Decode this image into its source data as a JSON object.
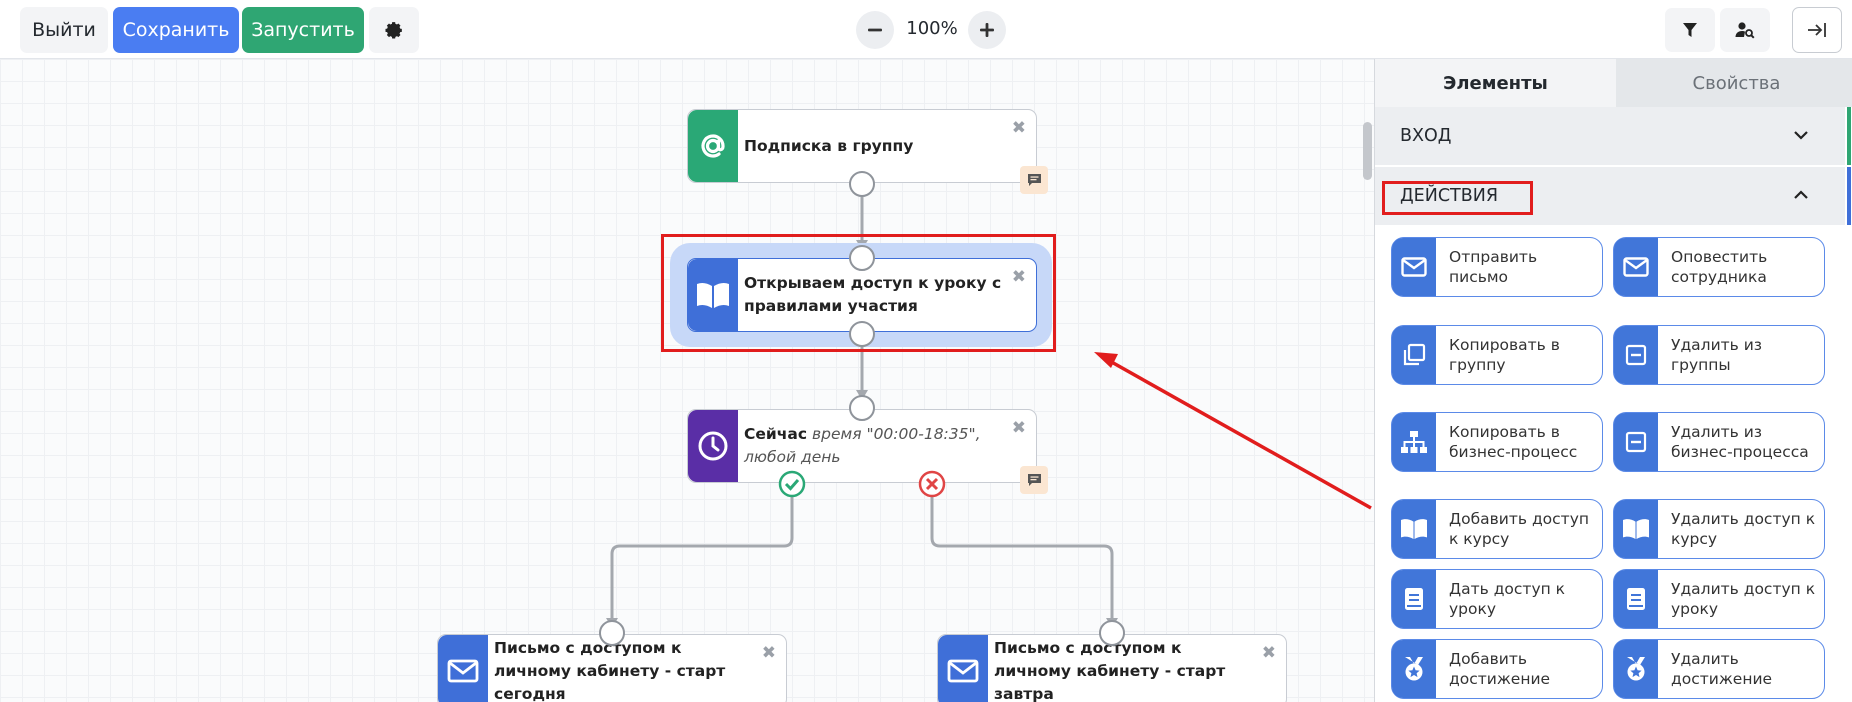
{
  "toolbar": {
    "exit_label": "Выйти",
    "save_label": "Сохранить",
    "run_label": "Запустить",
    "zoom_level": "100%",
    "colors": {
      "save": "#4a7df2",
      "run": "#2fa673"
    }
  },
  "canvas": {
    "nodes": [
      {
        "id": "subscribe",
        "title": "Подписка в группу",
        "icon": "at-icon",
        "color": "#2aa876"
      },
      {
        "id": "open-access",
        "title": "Открываем доступ к уроку с правилами участия",
        "icon": "book-icon",
        "color": "#3f6fd8"
      },
      {
        "id": "condition",
        "title": "Сейчас",
        "detail": "время \"00:00-18:35\", любой день",
        "icon": "clock-icon",
        "color": "#5a2ea6"
      },
      {
        "id": "letter-today",
        "title": "Письмо с доступом к личному кабинету - старт сегодня",
        "icon": "envelope-icon",
        "color": "#3f6fd8"
      },
      {
        "id": "letter-tomorrow",
        "title": "Письмо с доступом к личному кабинету - старт завтра",
        "icon": "envelope-icon",
        "color": "#3f6fd8"
      }
    ],
    "close_glyph": "✖"
  },
  "panel": {
    "tabs": {
      "elements": "Элементы",
      "properties": "Свойства"
    },
    "sections": {
      "input": "ВХОД",
      "actions": "ДЕЙСТВИЯ"
    },
    "section_colors": {
      "input": "#2fa673",
      "actions": "#3f6fd8"
    },
    "actions": [
      {
        "label": "Отправить письмо",
        "icon": "envelope-icon"
      },
      {
        "label": "Оповестить сотрудника",
        "icon": "envelope-icon"
      },
      {
        "label": "Копировать в группу",
        "icon": "copy-icon"
      },
      {
        "label": "Удалить из группы",
        "icon": "minus-box-icon"
      },
      {
        "label": "Копировать в бизнес-процесс",
        "icon": "sitemap-icon"
      },
      {
        "label": "Удалить из бизнес-процесса",
        "icon": "minus-box-icon"
      },
      {
        "label": "Добавить доступ к курсу",
        "icon": "book-icon"
      },
      {
        "label": "Удалить доступ к курсу",
        "icon": "book-icon"
      },
      {
        "label": "Дать доступ к уроку",
        "icon": "lesson-icon"
      },
      {
        "label": "Удалить доступ к уроку",
        "icon": "lesson-icon"
      },
      {
        "label": "Добавить достижение",
        "icon": "medal-icon"
      },
      {
        "label": "Удалить достижение",
        "icon": "medal-icon"
      }
    ]
  },
  "annotation": {
    "color": "#e11d1d"
  }
}
